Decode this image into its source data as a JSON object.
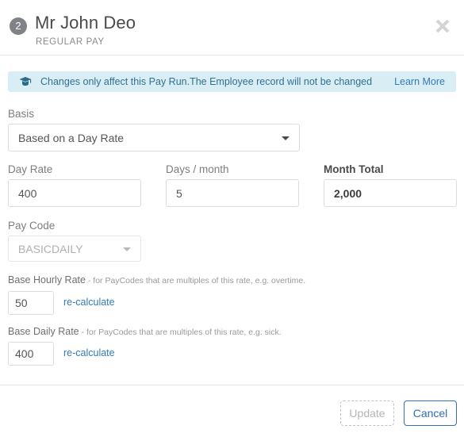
{
  "header": {
    "step_number": "2",
    "title": "Mr John Deo",
    "subtitle": "REGULAR PAY",
    "close_label": "close"
  },
  "banner": {
    "message": "Changes only affect this Pay Run.The Employee record will not be changed",
    "link_label": "Learn More",
    "icon": "graduation-cap-icon",
    "background_color": "#d9edf4",
    "text_color": "#31708f",
    "link_color": "#337ab7"
  },
  "form": {
    "basis": {
      "label": "Basis",
      "value": "Based on a Day Rate"
    },
    "day_rate": {
      "label": "Day Rate",
      "value": "400"
    },
    "days_per_month": {
      "label": "Days / month",
      "value": "5"
    },
    "month_total": {
      "label": "Month Total",
      "value": "2,000"
    },
    "pay_code": {
      "label": "Pay Code",
      "value": "BASICDAILY"
    },
    "base_hourly_rate": {
      "label": "Base Hourly Rate",
      "hint": " - for PayCodes that are multiples of this rate, e.g. overtime.",
      "value": "50",
      "recalculate_label": "re-calculate"
    },
    "base_daily_rate": {
      "label": "Base Daily Rate",
      "hint": " - for PayCodes that are multiples of this rate, e.g. sick.",
      "value": "400",
      "recalculate_label": "re-calculate"
    }
  },
  "footer": {
    "update_label": "Update",
    "cancel_label": "Cancel"
  }
}
